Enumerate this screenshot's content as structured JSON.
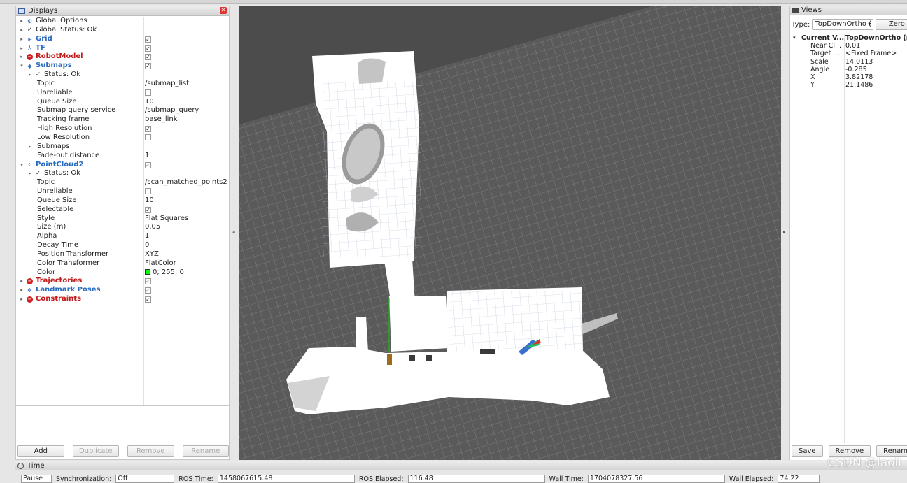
{
  "displays": {
    "title": "Displays",
    "rows": [
      {
        "name": "Global Options",
        "value": "",
        "kind": "plain",
        "icon": "gear-icon",
        "glyph": "⚙",
        "level": 1,
        "exp": "▸"
      },
      {
        "name": "Global Status: Ok",
        "value": "",
        "kind": "plain",
        "icon": "check-icon",
        "glyph": "✓",
        "level": 1,
        "exp": "▸"
      },
      {
        "name": "Grid",
        "value": "✓",
        "kind": "blue",
        "icon": "grid-icon",
        "glyph": "⊕",
        "level": 1,
        "exp": "▸",
        "checkbox": true
      },
      {
        "name": "TF",
        "value": "✓",
        "kind": "blue",
        "icon": "tf-icon",
        "glyph": "⅄",
        "level": 1,
        "exp": "▸",
        "checkbox": true
      },
      {
        "name": "RobotModel",
        "value": "✓",
        "kind": "red",
        "icon": "error-icon",
        "glyph": "−",
        "level": 1,
        "exp": "▸",
        "checkbox": true
      },
      {
        "name": "Submaps",
        "value": "✓",
        "kind": "blue",
        "icon": "submaps-icon",
        "glyph": "◆",
        "level": 1,
        "exp": "▾",
        "checkbox": true
      },
      {
        "name": "Status: Ok",
        "value": "",
        "kind": "plain",
        "icon": "check-icon",
        "glyph": "✓",
        "level": 2,
        "exp": "▸"
      },
      {
        "name": "Topic",
        "value": "/submap_list",
        "kind": "prop",
        "level": 2
      },
      {
        "name": "Unreliable",
        "value": "",
        "kind": "prop",
        "level": 2,
        "checkbox": true
      },
      {
        "name": "Queue Size",
        "value": "10",
        "kind": "prop",
        "level": 2
      },
      {
        "name": "Submap query service",
        "value": "/submap_query",
        "kind": "prop",
        "level": 2
      },
      {
        "name": "Tracking frame",
        "value": "base_link",
        "kind": "prop",
        "level": 2
      },
      {
        "name": "High Resolution",
        "value": "✓",
        "kind": "prop",
        "level": 2,
        "checkbox": true
      },
      {
        "name": "Low Resolution",
        "value": "",
        "kind": "prop",
        "level": 2,
        "checkbox": true
      },
      {
        "name": "Submaps",
        "value": "",
        "kind": "prop",
        "level": 2,
        "exp": "▸"
      },
      {
        "name": "Fade-out distance",
        "value": "1",
        "kind": "prop",
        "level": 2
      },
      {
        "name": "PointCloud2",
        "value": "✓",
        "kind": "blue",
        "icon": "pointcloud-icon",
        "glyph": "⁘",
        "level": 1,
        "exp": "▾",
        "checkbox": true
      },
      {
        "name": "Status: Ok",
        "value": "",
        "kind": "plain",
        "icon": "check-icon",
        "glyph": "✓",
        "level": 2,
        "exp": "▸"
      },
      {
        "name": "Topic",
        "value": "/scan_matched_points2",
        "kind": "prop",
        "level": 2
      },
      {
        "name": "Unreliable",
        "value": "",
        "kind": "prop",
        "level": 2,
        "checkbox": true
      },
      {
        "name": "Queue Size",
        "value": "10",
        "kind": "prop",
        "level": 2
      },
      {
        "name": "Selectable",
        "value": "✓",
        "kind": "prop",
        "level": 2,
        "checkbox": true
      },
      {
        "name": "Style",
        "value": "Flat Squares",
        "kind": "prop",
        "level": 2
      },
      {
        "name": "Size (m)",
        "value": "0.05",
        "kind": "prop",
        "level": 2
      },
      {
        "name": "Alpha",
        "value": "1",
        "kind": "prop",
        "level": 2
      },
      {
        "name": "Decay Time",
        "value": "0",
        "kind": "prop",
        "level": 2
      },
      {
        "name": "Position Transformer",
        "value": "XYZ",
        "kind": "prop",
        "level": 2
      },
      {
        "name": "Color Transformer",
        "value": "FlatColor",
        "kind": "prop",
        "level": 2
      },
      {
        "name": "Color",
        "value": "0; 255; 0",
        "kind": "prop",
        "level": 2,
        "swatch": "#00ff00"
      },
      {
        "name": "Trajectories",
        "value": "✓",
        "kind": "red",
        "icon": "error-icon",
        "glyph": "−",
        "level": 1,
        "exp": "▸",
        "checkbox": true
      },
      {
        "name": "Landmark Poses",
        "value": "✓",
        "kind": "blue",
        "icon": "landmark-icon",
        "glyph": "❖",
        "level": 1,
        "exp": "▸",
        "checkbox": true
      },
      {
        "name": "Constraints",
        "value": "✓",
        "kind": "red",
        "icon": "error-icon",
        "glyph": "−",
        "level": 1,
        "exp": "▸",
        "checkbox": true
      }
    ],
    "buttons": {
      "add": "Add",
      "duplicate": "Duplicate",
      "remove": "Remove",
      "rename": "Rename"
    }
  },
  "views": {
    "title": "Views",
    "type_label": "Type:",
    "type_value": "TopDownOrtho (",
    "zero_label": "Zero",
    "rows": [
      {
        "key": "Current V...",
        "value": "TopDownOrtho (rv",
        "bold": true,
        "exp": "▾"
      },
      {
        "key": "Near Cl...",
        "value": "0.01"
      },
      {
        "key": "Target ...",
        "value": "<Fixed Frame>"
      },
      {
        "key": "Scale",
        "value": "14.0113"
      },
      {
        "key": "Angle",
        "value": "-0.285"
      },
      {
        "key": "X",
        "value": "3.82178"
      },
      {
        "key": "Y",
        "value": "21.1486"
      }
    ],
    "buttons": {
      "save": "Save",
      "remove": "Remove",
      "rename": "Renam"
    }
  },
  "time": {
    "title": "Time",
    "pause": "Pause",
    "sync_label": "Synchronization:",
    "sync_value": "Off",
    "ros_time_label": "ROS Time:",
    "ros_time": "1458067615.48",
    "ros_elapsed_label": "ROS Elapsed:",
    "ros_elapsed": "116.48",
    "wall_time_label": "Wall Time:",
    "wall_time": "1704078327.56",
    "wall_elapsed_label": "Wall Elapsed:",
    "wall_elapsed": "74.22"
  },
  "watermark": "CSDN @laoli",
  "colors": {
    "accent_blue": "#2a6bbf",
    "error_red": "#c21a1a",
    "viewport_bg": "#4c4c4c",
    "grid": "#7a7a7a"
  }
}
